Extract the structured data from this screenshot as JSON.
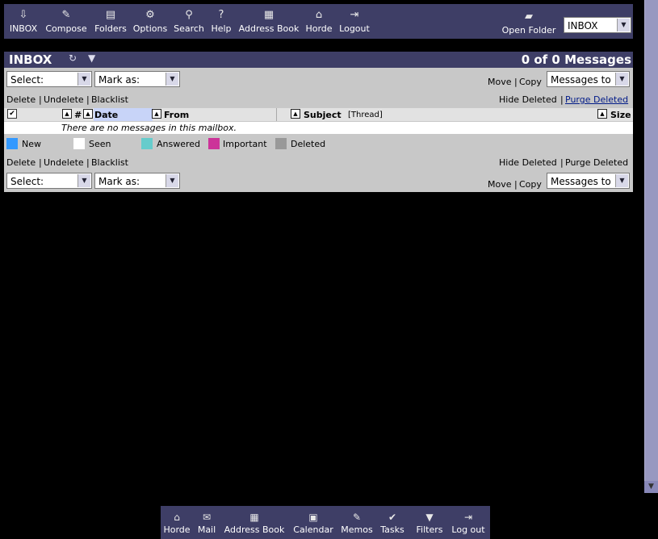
{
  "menu": {
    "items": [
      {
        "label": "INBOX",
        "icon": "inbox-icon",
        "glyph": "⇩"
      },
      {
        "label": "Compose",
        "icon": "compose-icon",
        "glyph": "✎"
      },
      {
        "label": "Folders",
        "icon": "folders-icon",
        "glyph": "▤"
      },
      {
        "label": "Options",
        "icon": "options-icon",
        "glyph": "⚙"
      },
      {
        "label": "Search",
        "icon": "search-icon",
        "glyph": "⚲"
      },
      {
        "label": "Help",
        "icon": "help-icon",
        "glyph": "?"
      },
      {
        "label": "Address Book",
        "icon": "address-book-icon",
        "glyph": "▦"
      },
      {
        "label": "Horde",
        "icon": "horde-home-icon",
        "glyph": "⌂"
      },
      {
        "label": "Logout",
        "icon": "logout-icon",
        "glyph": "⇥"
      }
    ],
    "open_folder_label": "Open Folder",
    "open_folder_icon": "open-folder-icon",
    "folder_select_value": "INBOX"
  },
  "mailbox": {
    "title": "INBOX",
    "count": "0 of 0 Messages",
    "select_value": "Select:",
    "mark_as_value": "Mark as:",
    "move_label": "Move",
    "copy_label": "Copy",
    "messages_to_value": "Messages to",
    "actions": {
      "delete": "Delete",
      "undelete": "Undelete",
      "blacklist": "Blacklist"
    },
    "hide_deleted": "Hide Deleted",
    "purge_deleted": "Purge Deleted",
    "columns": {
      "number": "#",
      "date": "Date",
      "from": "From",
      "subject": "Subject",
      "thread": "[Thread]",
      "size": "Size"
    },
    "empty_message": "There are no messages in this mailbox.",
    "legend": [
      {
        "label": "New",
        "color": "#3399ff"
      },
      {
        "label": "Seen",
        "color": "#ffffff"
      },
      {
        "label": "Answered",
        "color": "#66cccc"
      },
      {
        "label": "Important",
        "color": "#cc3399"
      },
      {
        "label": "Deleted",
        "color": "#999999"
      }
    ]
  },
  "bottom_menu": {
    "items": [
      {
        "label": "Horde",
        "icon": "horde-home-icon",
        "glyph": "⌂"
      },
      {
        "label": "Mail",
        "icon": "mail-icon",
        "glyph": "✉"
      },
      {
        "label": "Address Book",
        "icon": "address-book-icon",
        "glyph": "▦"
      },
      {
        "label": "Calendar",
        "icon": "calendar-icon",
        "glyph": "▣"
      },
      {
        "label": "Memos",
        "icon": "memos-icon",
        "glyph": "✎"
      },
      {
        "label": "Tasks",
        "icon": "tasks-icon",
        "glyph": "✔"
      },
      {
        "label": "Filters",
        "icon": "filters-icon",
        "glyph": "▼"
      },
      {
        "label": "Log out",
        "icon": "logout-icon",
        "glyph": "⇥"
      }
    ]
  },
  "colors": {
    "bar": "#3e3e66",
    "panel": "#c8c8c8",
    "date_highlight": "#c8d4f8"
  }
}
